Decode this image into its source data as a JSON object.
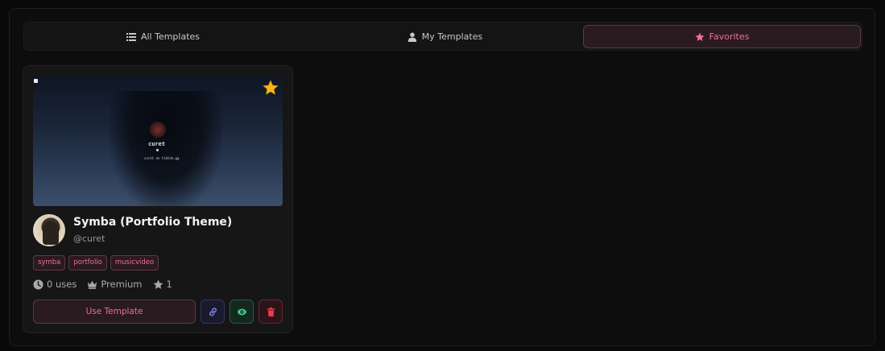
{
  "tabs": [
    {
      "label": "All Templates",
      "icon": "list-icon"
    },
    {
      "label": "My Templates",
      "icon": "user-icon"
    },
    {
      "label": "Favorites",
      "icon": "star-icon",
      "active": true
    }
  ],
  "card": {
    "thumbnail": {
      "name": "curet",
      "link": "curet on tiktok.gg"
    },
    "title": "Symba (Portfolio Theme)",
    "handle": "@curet",
    "tags": [
      "symba",
      "portfolio",
      "musicvideo"
    ],
    "stats": {
      "uses": "0 uses",
      "tier": "Premium",
      "stars": "1"
    },
    "use_label": "Use Template"
  },
  "colors": {
    "accent": "#f06d9b",
    "star": "#f5b417",
    "link_btn": "#7d83e6",
    "view_btn": "#3ed08a",
    "delete_btn": "#ee3a4c"
  }
}
